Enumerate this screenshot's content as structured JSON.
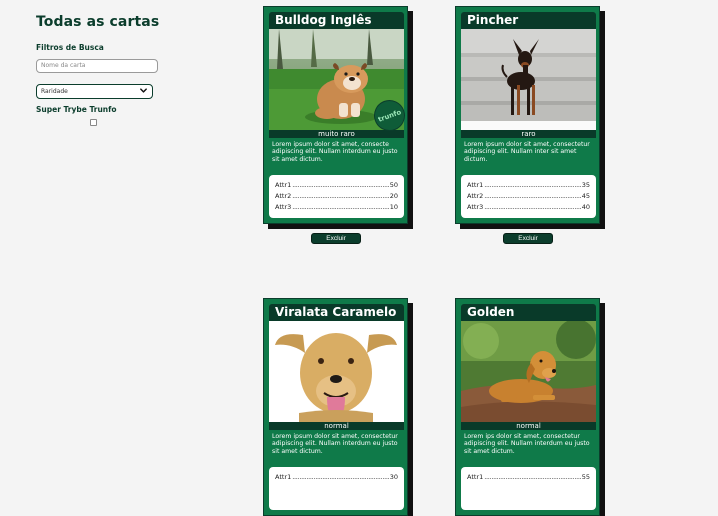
{
  "sidebar": {
    "title": "Todas as cartas",
    "filters_label": "Filtros de Busca",
    "name_placeholder": "Nome da carta",
    "rarity_selected": "Raridade",
    "trunfo_label": "Super Trybe Trunfo",
    "trunfo_checked": false
  },
  "cards": [
    {
      "name": "Bulldog Inglês",
      "image_alt": "English bulldog sitting on grass",
      "rarity": "muito raro",
      "description": "Lorem ipsum dolor sit amet, consecte adipiscing elit. Nullam interdum eu justo sit amet dictum.",
      "attr1_label": "Attr1",
      "attr1_value": "50",
      "attr2_label": "Attr2",
      "attr2_value": "20",
      "attr3_label": "Attr3",
      "attr3_value": "10",
      "trunfo": true,
      "trunfo_label": "trunfo",
      "delete_label": "Excluir"
    },
    {
      "name": "Pincher",
      "image_alt": "Miniature pinscher standing",
      "rarity": "raro",
      "description": "Lorem ipsum dolor sit amet, consectetur adipiscing elit. Nullam inter sit amet dictum.",
      "attr1_label": "Attr1",
      "attr1_value": "35",
      "attr2_label": "Attr2",
      "attr2_value": "45",
      "attr3_label": "Attr3",
      "attr3_value": "40",
      "trunfo": false,
      "delete_label": "Excluir"
    },
    {
      "name": "Viralata Caramelo",
      "image_alt": "Caramel mixed-breed dog with tongue out",
      "rarity": "normal",
      "description": "Lorem ipsum dolor sit amet, consectetur adipiscing elit. Nullam interdum eu justo sit amet dictum.",
      "attr1_label": "Attr1",
      "attr1_value": "30",
      "trunfo": false
    },
    {
      "name": "Golden",
      "image_alt": "Golden retriever lying on a path",
      "rarity": "normal",
      "description": "Lorem ips dolor sit amet, consectetur adipiscing elit. Nullam interdum eu justo sit amet dictum.",
      "attr1_label": "Attr1",
      "attr1_value": "55",
      "trunfo": false
    }
  ],
  "colors": {
    "card_green": "#0f7a49",
    "dark_green": "#093a29",
    "page_bg": "#f4f4f4"
  }
}
